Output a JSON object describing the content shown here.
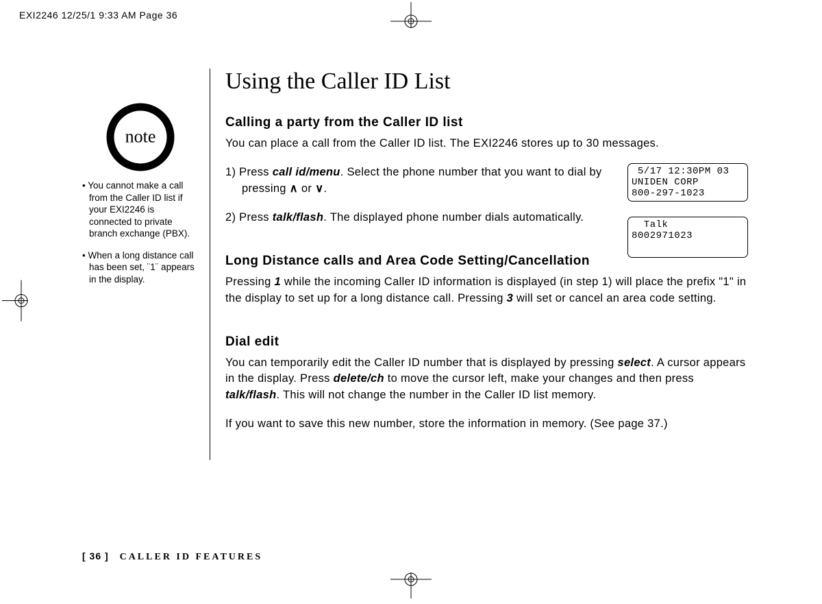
{
  "meta": {
    "slug": "EXI2246  12/25/1 9:33 AM  Page 36"
  },
  "sidebar": {
    "note_label": "note",
    "items": [
      "• You cannot make a call from the Caller ID list if your EXI2246 is connected to private branch exchange (PBX).",
      "• When a long distance call has been set, ¨1¨ appears in the display."
    ]
  },
  "main": {
    "title": "Using the Caller ID List",
    "section1": {
      "heading": "Calling a party from the Caller ID list",
      "intro": "You can place a call from the Caller ID list. The EXI2246 stores up to 30 messages.",
      "step1_prefix": "1) Press ",
      "step1_key1": "call id/menu",
      "step1_mid": ". Select the phone number that you want to dial by pressing ",
      "step1_arrow_up": "∧",
      "step1_or": " or ",
      "step1_arrow_down": "∨",
      "step1_end": ".",
      "step2_prefix": "2) Press ",
      "step2_key": "talk/flash",
      "step2_end": ". The displayed phone number dials automatically."
    },
    "section2": {
      "heading": "Long Distance calls and Area Code Setting/Cancellation",
      "p_prefix": "Pressing ",
      "p_key1": "1",
      "p_mid1": " while the incoming Caller ID information is displayed (in step 1) will place the prefix \"1\" in the display to set up for a long distance call. Pressing ",
      "p_key2": "3",
      "p_end": " will set or cancel an area code setting."
    },
    "section3": {
      "heading": "Dial edit",
      "p1_prefix": "You can temporarily edit the Caller ID number that is displayed by pressing ",
      "p1_key1": "select",
      "p1_mid1": ". A cursor appears in the display. Press ",
      "p1_key2": "delete/ch",
      "p1_mid2": " to move the cursor left, make your changes and then press ",
      "p1_key3": "talk/flash",
      "p1_end": ". This will not change the number in the Caller ID list memory.",
      "p2": "If you want to save this new number, store the information in memory. (See page 37.)"
    },
    "lcd1": " 5/17 12:30PM 03\nUNIDEN CORP\n800-297-1023",
    "lcd2": "  Talk\n8002971023"
  },
  "footer": {
    "page": "[ 36 ]",
    "section": "CALLER ID FEATURES"
  }
}
